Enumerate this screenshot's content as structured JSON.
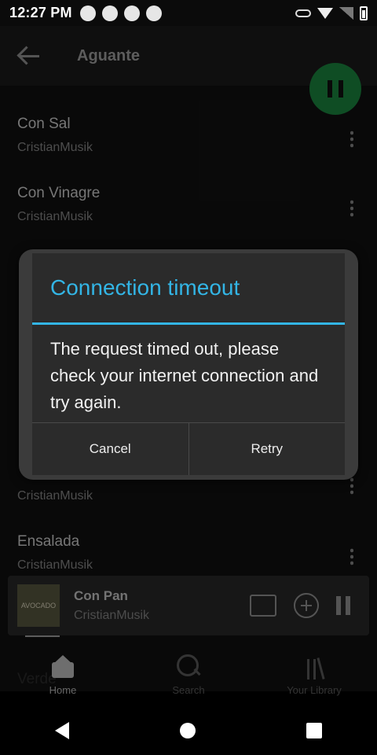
{
  "status_bar": {
    "time": "12:27 PM",
    "left_icons": [
      "spotify-icon",
      "app-icon",
      "app-icon-2",
      "vpn-icon"
    ],
    "right_icons": [
      "key-icon",
      "wifi-icon",
      "signal-icon",
      "battery-icon"
    ]
  },
  "header": {
    "title": "Aguante"
  },
  "tracks": [
    {
      "title": "Con Sal",
      "artist": "CristianMusik"
    },
    {
      "title": "Con Vinagre",
      "artist": "CristianMusik"
    },
    {
      "title": "Ensalada",
      "artist": "CristianMusik"
    }
  ],
  "partial_rows": [
    {
      "artist": "CristianMusik"
    },
    {
      "artist": "CristianMusik"
    },
    {
      "title": "Verde"
    }
  ],
  "now_playing": {
    "title": "Con Pan",
    "artist": "CristianMusik",
    "album_art_text": "AVOCADO"
  },
  "bottom_nav": [
    {
      "label": "Home",
      "icon": "home-icon",
      "active": true
    },
    {
      "label": "Search",
      "icon": "search-icon",
      "active": false
    },
    {
      "label": "Your Library",
      "icon": "library-icon",
      "active": false
    }
  ],
  "dialog": {
    "title": "Connection timeout",
    "message": "The request timed out, please check your internet connection and try again.",
    "cancel_label": "Cancel",
    "retry_label": "Retry"
  },
  "colors": {
    "dialog_accent": "#33b5e5",
    "spotify_green": "#1d8c43",
    "background": "#121212"
  }
}
